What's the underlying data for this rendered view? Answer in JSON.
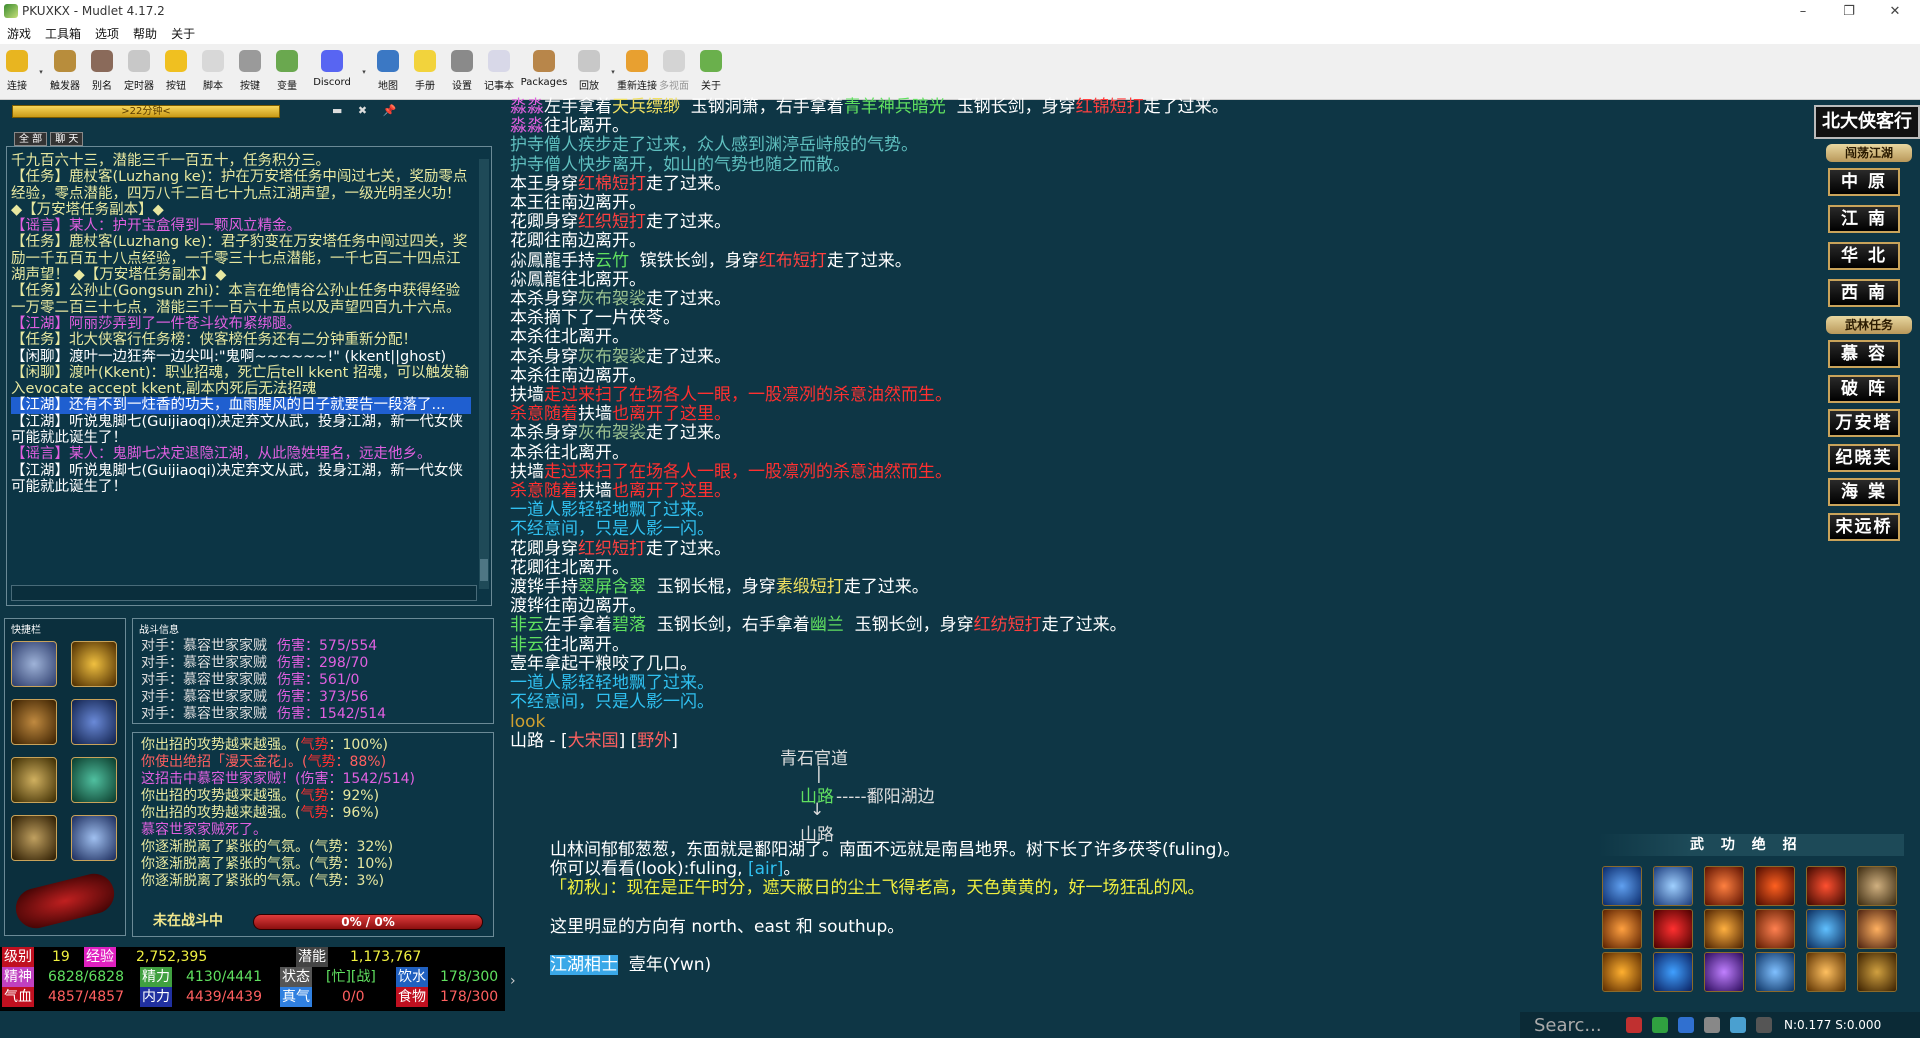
{
  "window": {
    "title": "PKUXKX - Mudlet 4.17.2",
    "min": "–",
    "max": "❐",
    "close": "✕"
  },
  "menu": [
    "游戏",
    "工具箱",
    "选项",
    "帮助",
    "关于"
  ],
  "toolbar": [
    {
      "label": "连接",
      "icon": "connect-icon",
      "color": "#e8b520",
      "drop": true
    },
    {
      "label": "触发器",
      "icon": "trigger-icon",
      "color": "#b88d3c",
      "drop": false
    },
    {
      "label": "别名",
      "icon": "alias-icon",
      "color": "#8a6a5a",
      "drop": false
    },
    {
      "label": "定时器",
      "icon": "timer-icon",
      "color": "#c8c8c8",
      "drop": false
    },
    {
      "label": "按钮",
      "icon": "button-icon",
      "color": "#f0c020",
      "drop": false
    },
    {
      "label": "脚本",
      "icon": "script-icon",
      "color": "#d8d8d8",
      "drop": false
    },
    {
      "label": "按键",
      "icon": "keys-icon",
      "color": "#9a9a9a",
      "drop": false
    },
    {
      "label": "变量",
      "icon": "variables-icon",
      "color": "#6aa84f",
      "drop": false
    },
    {
      "label": "Discord",
      "icon": "discord-icon",
      "color": "#5865f2",
      "drop": true
    },
    {
      "label": "地图",
      "icon": "map-icon",
      "color": "#3b78c4",
      "drop": false
    },
    {
      "label": "手册",
      "icon": "manual-icon",
      "color": "#f2d33c",
      "drop": false
    },
    {
      "label": "设置",
      "icon": "settings-icon",
      "color": "#8a8a8a",
      "drop": false
    },
    {
      "label": "记事本",
      "icon": "notepad-icon",
      "color": "#d8d8e8",
      "drop": false
    },
    {
      "label": "Packages",
      "icon": "packages-icon",
      "color": "#b8864a",
      "drop": false
    },
    {
      "label": "回放",
      "icon": "replay-icon",
      "color": "#c8c8c8",
      "drop": true
    },
    {
      "label": "重新连接",
      "icon": "reconnect-icon",
      "color": "#e8a030",
      "drop": false
    },
    {
      "label": "多视面",
      "icon": "multiview-icon",
      "color": "#aaaaaa",
      "drop": false,
      "disabled": true
    },
    {
      "label": "关于",
      "icon": "about-icon",
      "color": "#6ab04c",
      "drop": false
    }
  ],
  "timer": {
    "text": ">22分钟<",
    "icons": "▬ ✖ 📌"
  },
  "chat_tabs": [
    "全 部",
    "聊 天"
  ],
  "chat": [
    {
      "t": "千九百六十三，潜能三千一百五十，任务积分三。",
      "c": "#e8e8a0"
    },
    {
      "t": "【任务】鹿杖客(Luzhang ke)：护在万安塔任务中闯过七关，奖励零点经验，零点潜能，四万八千二百七十九点江湖声望，一级光明圣火功！ ◆【万安塔任务副本】◆",
      "c": "#e8e8a0"
    },
    {
      "t": "【谣言】某人：护开宝盒得到一颗风立精金。",
      "c": "#e060e0"
    },
    {
      "t": "【任务】鹿杖客(Luzhang ke)：君子豹变在万安塔任务中闯过四关，奖励一千五百五十八点经验，一千零三十七点潜能，一千七百二十四点江湖声望！ ◆【万安塔任务副本】◆",
      "c": "#e8e8a0"
    },
    {
      "t": "【任务】公孙止(Gongsun zhi)：本言在绝情谷公孙止任务中获得经验一万零二百三十七点，潜能三千一百六十五点以及声望四百九十六点。",
      "c": "#e8e8a0"
    },
    {
      "t": "【江湖】阿丽莎弄到了一件苍斗纹布紧绑腿。",
      "c": "#e060e0"
    },
    {
      "t": "【任务】北大侠客行任务榜：侠客榜任务还有二分钟重新分配！",
      "c": "#e8e8a0"
    },
    {
      "t": "【闲聊】渡叶一边狂奔一边尖叫:\"鬼啊~~~~~~!\" (kkent||ghost)",
      "c": "#ffffff"
    },
    {
      "t": "【闲聊】渡叶(Kkent)：职业招魂，死亡后tell kkent 招魂，可以触发输入evocate accept kkent,副本内死后无法招魂",
      "c": "#e8e8a0"
    },
    {
      "t": "【江湖】还有不到一炷香的功夫，血雨腥风的日子就要告一段落了...",
      "c": "#ffffff",
      "hl": true
    },
    {
      "t": "【江湖】听说鬼脚七(Guijiaoqi)决定弃文从武，投身江湖，新一代女侠可能就此诞生了！",
      "c": "#ffffff"
    },
    {
      "t": "【谣言】某人：鬼脚七决定退隐江湖，从此隐姓埋名，远走他乡。",
      "c": "#e060e0"
    },
    {
      "t": "【江湖】听说鬼脚七(Guijiaoqi)决定弃文从武，投身江湖，新一代女侠可能就此诞生了！",
      "c": "#ffffff"
    }
  ],
  "quick_title": "快捷栏",
  "battle_title": "战斗信息",
  "battle": [
    {
      "who": "对手：慕容世家家贼",
      "lab": "伤害：",
      "val": "575/554"
    },
    {
      "who": "对手：慕容世家家贼",
      "lab": "伤害：",
      "val": "298/70"
    },
    {
      "who": "对手：慕容世家家贼",
      "lab": "伤害：",
      "val": "561/0"
    },
    {
      "who": "对手：慕容世家家贼",
      "lab": "伤害：",
      "val": "373/56"
    },
    {
      "who": "对手：慕容世家家贼",
      "lab": "伤害：",
      "val": "1542/514"
    }
  ],
  "fight": [
    {
      "t": "你出招的攻势越来越强。(",
      "m": "气势",
      "e": "：100%)",
      "c": "#e8e8a0"
    },
    {
      "t": "你使出绝招「漫天金花」。(",
      "m": "气势",
      "e": "：88%)",
      "c": "#ff6060"
    },
    {
      "t": "这招击中慕容世家家贼！(伤害：1542/514)",
      "m": "",
      "e": "",
      "c": "#e060e0"
    },
    {
      "t": "你出招的攻势越来越强。(",
      "m": "气势",
      "e": "：92%)",
      "c": "#e8e8a0"
    },
    {
      "t": "你出招的攻势越来越强。(",
      "m": "气势",
      "e": "：96%)",
      "c": "#e8e8a0"
    },
    {
      "t": "慕容世家家贼死了。",
      "m": "",
      "e": "",
      "c": "#e060e0"
    },
    {
      "t": "你逐渐脱离了紧张的气氛。(气势：32%)",
      "m": "",
      "e": "",
      "c": "#e8e8a0"
    },
    {
      "t": "你逐渐脱离了紧张的气氛。(气势：10%)",
      "m": "",
      "e": "",
      "c": "#e8e8a0"
    },
    {
      "t": "你逐渐脱离了紧张的气氛。(气势：3%)",
      "m": "",
      "e": "",
      "c": "#e8e8a0"
    }
  ],
  "fight_status": "未在战斗中",
  "fight_bar": "0% / 0%",
  "fight_bar_fill": 0,
  "status": {
    "level_l": "级别",
    "level": "19",
    "exp_l": "经验",
    "exp": "2,752,395",
    "pot_l": "潜能",
    "pot": "1,173,767",
    "jing_l": "精神",
    "jing": "6828/6828",
    "jl_l": "精力",
    "jl": "4130/4441",
    "zt_l": "状态",
    "zt": "[忙][战]",
    "water_l": "饮水",
    "water": "178/300",
    "qx_l": "气血",
    "qx": "4857/4857",
    "nl_l": "内力",
    "nl": "4439/4439",
    "zq_l": "真气",
    "zq": "0/0",
    "food_l": "食物",
    "food": "178/300",
    "arrow": "›"
  },
  "output": [
    [
      [
        "淼淼",
        "#e060e0"
      ],
      [
        "左手拿着",
        "#ffffff"
      ],
      [
        "天兵缥缈",
        "#f0e060"
      ],
      [
        "  玉钢洞箫，右手拿着",
        "#ffffff"
      ],
      [
        "青羊神兵暗光",
        "#60e060"
      ],
      [
        "  玉钢长剑，身穿",
        "#ffffff"
      ],
      [
        "红锦短打",
        "#ff4040"
      ],
      [
        "走了过来。",
        "#ffffff"
      ]
    ],
    [
      [
        "淼淼",
        "#e060e0"
      ],
      [
        "往北离开。",
        "#ffffff"
      ]
    ],
    [
      [
        "护寺僧人疾步走了过来，众人感到渊渟岳峙般的气势。",
        "#5fbfbf"
      ]
    ],
    [
      [
        "护寺僧人快步离开，如山的气势也随之而散。",
        "#5fbfbf"
      ]
    ],
    [
      [
        "本王身穿",
        "#ffffff"
      ],
      [
        "红棉短打",
        "#ff4040"
      ],
      [
        "走了过来。",
        "#ffffff"
      ]
    ],
    [
      [
        "本王往南边离开。",
        "#ffffff"
      ]
    ],
    [
      [
        "花卿身穿",
        "#ffffff"
      ],
      [
        "红织短打",
        "#ff4040"
      ],
      [
        "走了过来。",
        "#ffffff"
      ]
    ],
    [
      [
        "花卿往南边离开。",
        "#ffffff"
      ]
    ],
    [
      [
        "尛鳳龍手持",
        "#ffffff"
      ],
      [
        "云竹",
        "#60e060"
      ],
      [
        "  镔铁长剑，身穿",
        "#ffffff"
      ],
      [
        "红布短打",
        "#ff4040"
      ],
      [
        "走了过来。",
        "#ffffff"
      ]
    ],
    [
      [
        "尛鳳龍往北离开。",
        "#ffffff"
      ]
    ],
    [
      [
        "本杀身穿",
        "#ffffff"
      ],
      [
        "灰布袈裟",
        "#9ac090"
      ],
      [
        "走了过来。",
        "#ffffff"
      ]
    ],
    [
      [
        "本杀摘下了一片茯苓。",
        "#ffffff"
      ]
    ],
    [
      [
        "本杀往北离开。",
        "#ffffff"
      ]
    ],
    [
      [
        "本杀身穿",
        "#ffffff"
      ],
      [
        "灰布袈裟",
        "#9ac090"
      ],
      [
        "走了过来。",
        "#ffffff"
      ]
    ],
    [
      [
        "本杀往南边离开。",
        "#ffffff"
      ]
    ],
    [
      [
        "扶墙",
        "#ffffff"
      ],
      [
        "走过来扫了在场各人一眼，一股凛冽的杀意油然而生。",
        "#ff3030"
      ]
    ],
    [
      [
        "杀意随着",
        "#ff3030"
      ],
      [
        "扶墙",
        "#ffffff"
      ],
      [
        "也离开了这里。",
        "#ff3030"
      ]
    ],
    [
      [
        "本杀身穿",
        "#ffffff"
      ],
      [
        "灰布袈裟",
        "#9ac090"
      ],
      [
        "走了过来。",
        "#ffffff"
      ]
    ],
    [
      [
        "本杀往北离开。",
        "#ffffff"
      ]
    ],
    [
      [
        "扶墙",
        "#ffffff"
      ],
      [
        "走过来扫了在场各人一眼，一股凛冽的杀意油然而生。",
        "#ff3030"
      ]
    ],
    [
      [
        "杀意随着",
        "#ff3030"
      ],
      [
        "扶墙",
        "#ffffff"
      ],
      [
        "也离开了这里。",
        "#ff3030"
      ]
    ],
    [
      [
        "一道人影轻轻地飘了过来。",
        "#30c0f0"
      ]
    ],
    [
      [
        "不经意间，只是人影一闪。",
        "#30c0f0"
      ]
    ],
    [
      [
        "花卿身穿",
        "#ffffff"
      ],
      [
        "红织短打",
        "#ff4040"
      ],
      [
        "走了过来。",
        "#ffffff"
      ]
    ],
    [
      [
        "花卿往北离开。",
        "#ffffff"
      ]
    ],
    [
      [
        "渡铧手持",
        "#ffffff"
      ],
      [
        "翠屏含翠",
        "#60e060"
      ],
      [
        "  玉钢长棍，身穿",
        "#ffffff"
      ],
      [
        "素缎短打",
        "#f0e060"
      ],
      [
        "走了过来。",
        "#ffffff"
      ]
    ],
    [
      [
        "渡铧往南边离开。",
        "#ffffff"
      ]
    ],
    [
      [
        "非云",
        "#60e060"
      ],
      [
        "左手拿着",
        "#ffffff"
      ],
      [
        "碧落",
        "#60e060"
      ],
      [
        "  玉钢长剑，右手拿着",
        "#ffffff"
      ],
      [
        "幽兰",
        "#60e060"
      ],
      [
        "  玉钢长剑，身穿",
        "#ffffff"
      ],
      [
        "红纺短打",
        "#ff4040"
      ],
      [
        "走了过来。",
        "#ffffff"
      ]
    ],
    [
      [
        "非云",
        "#60e060"
      ],
      [
        "往北离开。",
        "#ffffff"
      ]
    ],
    [
      [
        "壹年拿起干粮咬了几口。",
        "#ffffff"
      ]
    ],
    [
      [
        "一道人影轻轻地飘了过来。",
        "#30c0f0"
      ]
    ],
    [
      [
        "不经意间，只是人影一闪。",
        "#30c0f0"
      ]
    ],
    [
      [
        "look",
        "#d0a030"
      ]
    ],
    [
      [
        "山路 - [",
        "#ffffff"
      ],
      [
        "大宋国",
        "#ff6060"
      ],
      [
        "] [",
        "#ffffff"
      ],
      [
        "野外",
        "#ff6060"
      ],
      [
        "]",
        "#ffffff"
      ]
    ]
  ],
  "map": {
    "north": "青石官道",
    "pipe": "|",
    "here": "山路",
    "east": "-----鄱阳湖边",
    "arrow": "↓",
    "south": "山路"
  },
  "desc": [
    [
      [
        "山林间郁郁葱葱，东面就是鄱阳湖了。南面不远就是南昌地界。树下长了许多茯苓(fuling)。",
        "#ffffff"
      ]
    ],
    [
      [
        "你可以看看(look):fuling, ",
        "#ffffff"
      ],
      [
        "[air]",
        "#30c0f0"
      ],
      [
        "。",
        "#ffffff"
      ]
    ],
    [
      [
        "「初秋」：现在是正午时分，遮天蔽日的尘土飞得老高，天色黄黄的，好一场狂乱的风。",
        "#f0f040"
      ]
    ],
    [
      [
        "",
        "#ffffff"
      ]
    ],
    [
      [
        "这里明显的方向有 north、east 和 southup。",
        "#ffffff"
      ]
    ],
    [
      [
        "",
        "#ffffff"
      ]
    ],
    [
      [
        "江湖相士",
        "#ffffff",
        "hl"
      ],
      [
        "  壹年(Ywn)",
        "#ffffff"
      ]
    ]
  ],
  "badge": "北大侠客行",
  "sections": [
    "闯荡江湖",
    "武林任务"
  ],
  "nav1": [
    "中 原",
    "江 南",
    "华 北",
    "西 南"
  ],
  "nav2": [
    "慕 容",
    "破 阵",
    "万安塔",
    "纪晓芙",
    "海 棠",
    "宋远桥"
  ],
  "wugong": "武 功 绝 招",
  "tray": {
    "search": "Searc...",
    "stats": "N:0.177 S:0.000"
  }
}
